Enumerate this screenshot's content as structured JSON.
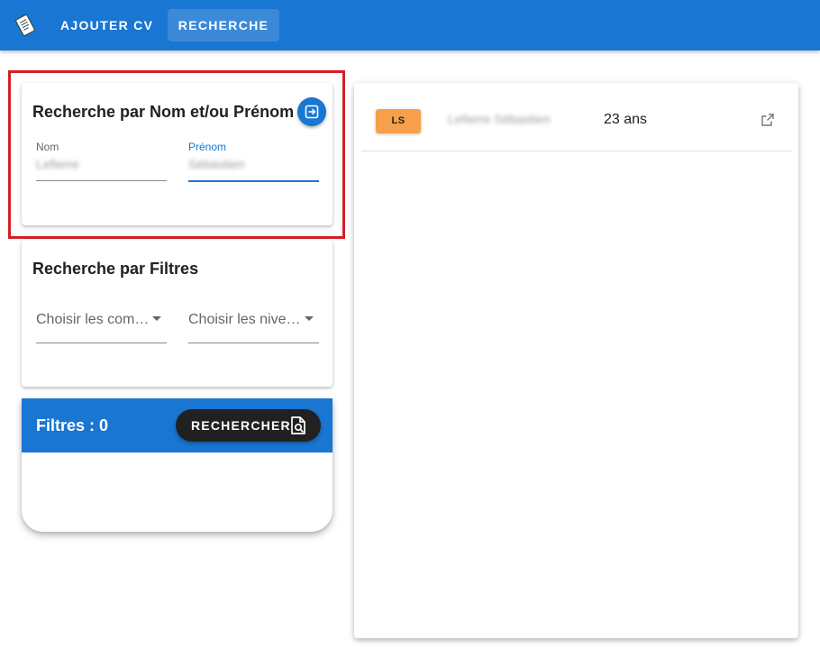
{
  "topbar": {
    "app_icon": "document-icon",
    "nav": [
      {
        "label": "AJOUTER CV",
        "active": false
      },
      {
        "label": "RECHERCHE",
        "active": true
      }
    ],
    "color": "#1976d2"
  },
  "name_search": {
    "title": "Recherche par Nom et/ou Prénom",
    "submit_icon": "arrow-right-box-icon",
    "nom": {
      "label": "Nom",
      "value": "Lefierre"
    },
    "prenom": {
      "label": "Prénom",
      "value": "Sébastien",
      "focused": true
    }
  },
  "filter_search": {
    "title": "Recherche par Filtres",
    "competences": {
      "placeholder": "Choisir les compétences"
    },
    "niveaux": {
      "placeholder": "Choisir les niveaux"
    }
  },
  "summary": {
    "title": "Filtres : 0",
    "search_button": {
      "label": "RECHERCHER",
      "icon": "file-search-icon"
    }
  },
  "results": [
    {
      "initials": "LS",
      "name": "Lefierre Sébastien",
      "age": "23 ans",
      "chip_color": "#f7a04b",
      "action_icon": "open-in-new-icon"
    }
  ],
  "highlight_color": "#d32027"
}
